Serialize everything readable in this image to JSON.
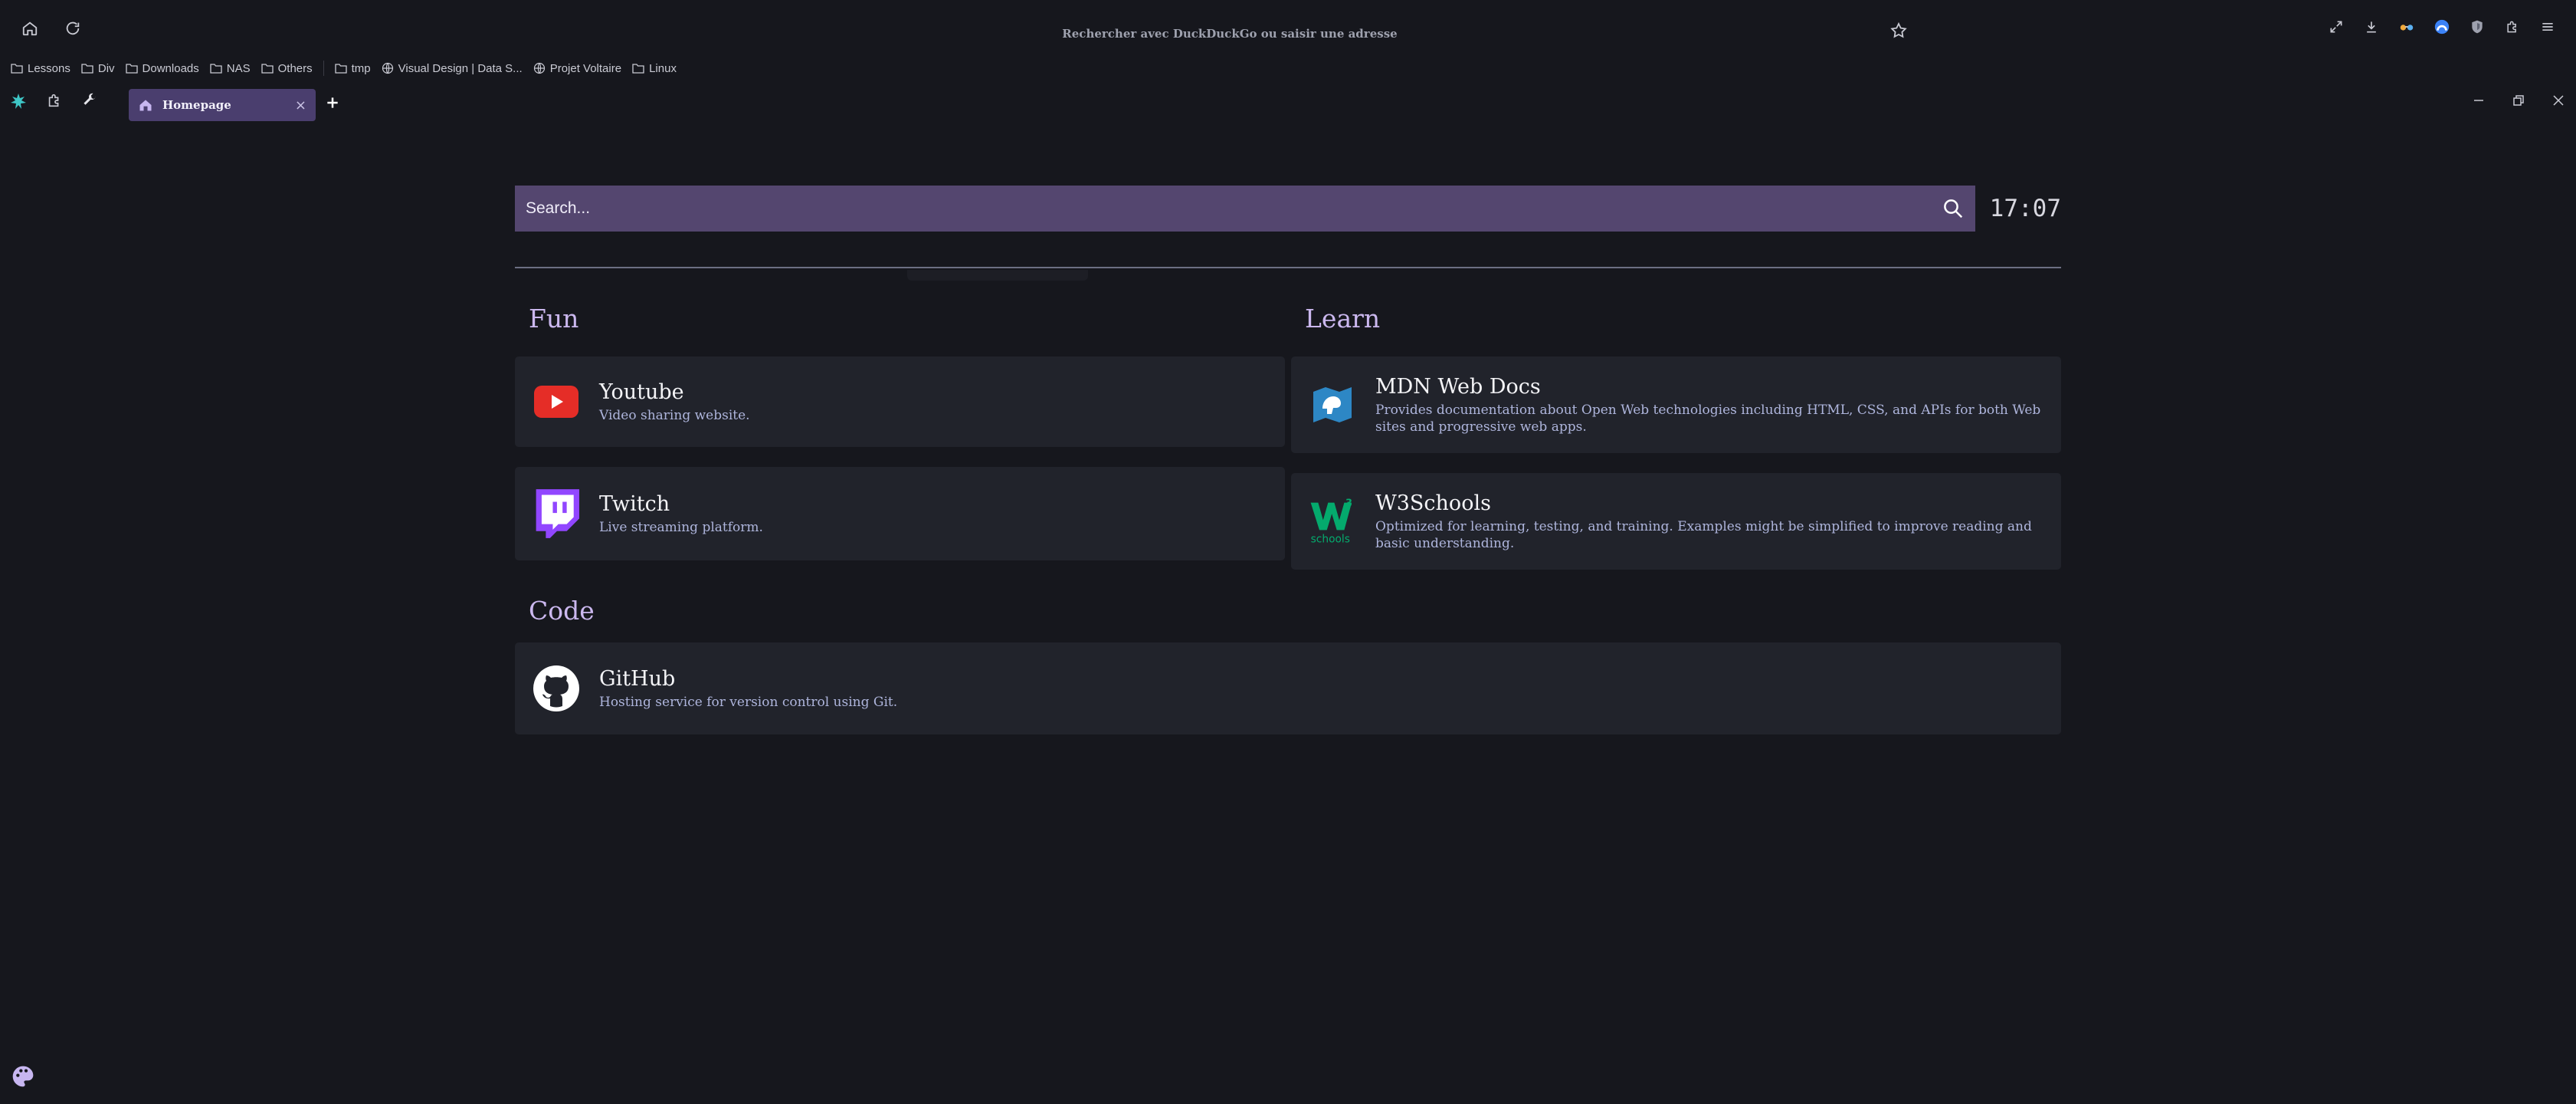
{
  "browser": {
    "urlbar_placeholder": "Rechercher avec DuckDuckGo ou saisir une adresse",
    "bookmarks": [
      "Lessons",
      "Div",
      "Downloads",
      "NAS",
      "Others",
      "tmp",
      "Visual Design | Data S...",
      "Projet Voltaire",
      "Linux"
    ],
    "tab_title": "Homepage",
    "tab_close": "×",
    "new_tab": "+"
  },
  "search": {
    "placeholder": "Search..."
  },
  "clock": "17:07",
  "sections": {
    "fun": {
      "title": "Fun",
      "items": [
        {
          "name": "Youtube",
          "desc": "Video sharing website.",
          "icon": "youtube-icon"
        },
        {
          "name": "Twitch",
          "desc": "Live streaming platform.",
          "icon": "twitch-icon"
        }
      ]
    },
    "learn": {
      "title": "Learn",
      "items": [
        {
          "name": "MDN Web Docs",
          "desc": "Provides documentation about Open Web technologies including HTML, CSS, and APIs for both Web sites and progressive web apps.",
          "icon": "mdn-icon"
        },
        {
          "name": "W3Schools",
          "desc": "Optimized for learning, testing, and training. Examples might be simplified to improve reading and basic understanding.",
          "icon": "w3schools-icon"
        }
      ]
    },
    "code": {
      "title": "Code",
      "items": [
        {
          "name": "GitHub",
          "desc": "Hosting service for version control using Git.",
          "icon": "github-icon"
        }
      ]
    }
  },
  "colors": {
    "background": "#16171d",
    "card": "#21232b",
    "search": "#54466f",
    "accent_title": "#cbb8ef",
    "tab_active": "#4a3e6e"
  }
}
